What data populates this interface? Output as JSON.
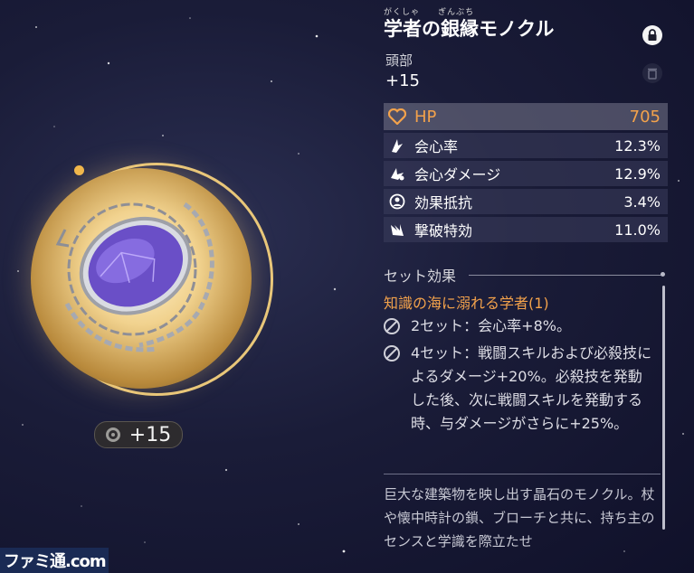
{
  "relic": {
    "title": "学者の銀縁モノクル",
    "ruby": [
      "がくしゃ",
      "ぎんぶち"
    ],
    "slot": "頭部",
    "level": "+15",
    "level_badge": "+15"
  },
  "stats": {
    "main": {
      "name": "HP",
      "value": "705",
      "icon": "heart-icon"
    },
    "subs": [
      {
        "name": "会心率",
        "value": "12.3%",
        "icon": "crit-rate-icon"
      },
      {
        "name": "会心ダメージ",
        "value": "12.9%",
        "icon": "crit-dmg-icon"
      },
      {
        "name": "効果抵抗",
        "value": "3.4%",
        "icon": "effect-res-icon"
      },
      {
        "name": "撃破特効",
        "value": "11.0%",
        "icon": "break-effect-icon"
      }
    ]
  },
  "set_effect": {
    "heading": "セット効果",
    "set_name": "知識の海に溺れる学者(1)",
    "effects": [
      {
        "text": "2セット：会心率+8%。"
      },
      {
        "text": "4セット：戦闘スキルおよび必殺技によるダメージ+20%。必殺技を発動した後、次に戦闘スキルを発動する時、与ダメージがさらに+25%。"
      }
    ]
  },
  "description": "巨大な建築物を映し出す晶石のモノクル。杖や懐中時計の鎖、ブローチと共に、持ち主のセンスと学識を際立たせ",
  "watermark": "ファミ通.com",
  "colors": {
    "accent": "#f3a24b",
    "ring": "#e9c77a",
    "lens": "#6a4fc7"
  }
}
